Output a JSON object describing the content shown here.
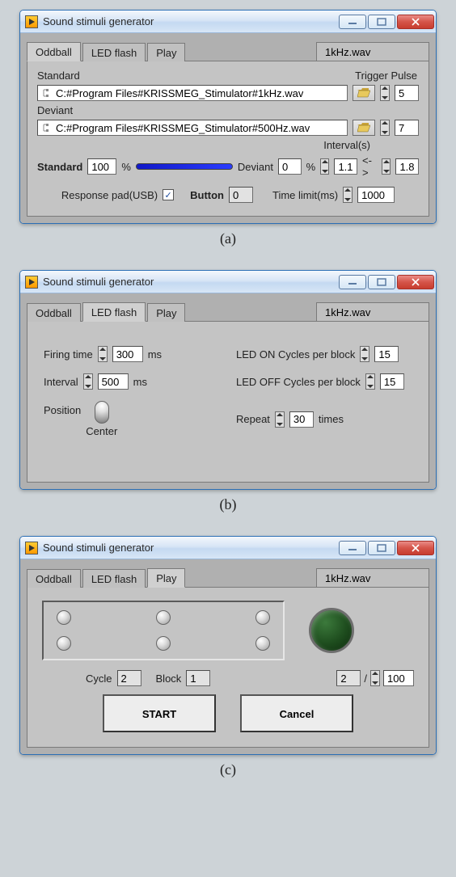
{
  "windows": {
    "a": {
      "title": "Sound stimuli generator",
      "tabs": {
        "oddball": "Oddball",
        "led": "LED flash",
        "play": "Play"
      },
      "active_tab": "oddball",
      "filetab": "1kHz.wav",
      "trigger_pulse_label": "Trigger Pulse",
      "standard_label": "Standard",
      "standard_path": "C:#Program Files#KRISSMEG_Stimulator#1kHz.wav",
      "standard_trigger": "5",
      "deviant_label": "Deviant",
      "deviant_path": "C:#Program Files#KRISSMEG_Stimulator#500Hz.wav",
      "deviant_trigger": "7",
      "standard_pct_label": "Standard",
      "standard_pct": "100",
      "pct_sign": "%",
      "deviant_pct_label": "Deviant",
      "deviant_pct": "0",
      "interval_label": "Interval(s)",
      "interval_from": "1.1",
      "interval_sep": "<->",
      "interval_to": "1.8",
      "response_pad_label": "Response pad(USB)",
      "response_pad_checked": "✓",
      "button_label": "Button",
      "button_value": "0",
      "time_limit_label": "Time limit(ms)",
      "time_limit_value": "1000"
    },
    "b": {
      "title": "Sound stimuli generator",
      "tabs": {
        "oddball": "Oddball",
        "led": "LED flash",
        "play": "Play"
      },
      "active_tab": "led",
      "filetab": "1kHz.wav",
      "firing_label": "Firing time",
      "firing_value": "300",
      "ms": "ms",
      "interval_label": "Interval",
      "interval_value": "500",
      "ledon_label": "LED ON Cycles per block",
      "ledon_value": "15",
      "ledoff_label": "LED OFF Cycles per block",
      "ledoff_value": "15",
      "position_label": "Position",
      "position_value": "Center",
      "repeat_label": "Repeat",
      "repeat_value": "30",
      "times": "times"
    },
    "c": {
      "title": "Sound stimuli generator",
      "tabs": {
        "oddball": "Oddball",
        "led": "LED flash",
        "play": "Play"
      },
      "active_tab": "play",
      "filetab": "1kHz.wav",
      "cycle_label": "Cycle",
      "cycle_value": "2",
      "block_label": "Block",
      "block_value": "1",
      "progress_current": "2",
      "progress_sep": "/",
      "progress_total": "100",
      "start_label": "START",
      "cancel_label": "Cancel"
    }
  },
  "captions": {
    "a": "(a)",
    "b": "(b)",
    "c": "(c)"
  }
}
